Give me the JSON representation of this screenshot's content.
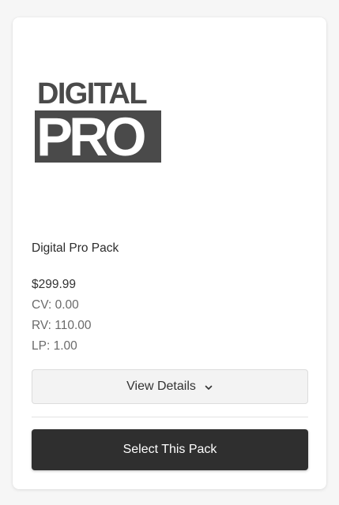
{
  "product": {
    "logo": {
      "top_text": "DIGITAL",
      "bottom_text": "PRO"
    },
    "name": "Digital Pro Pack",
    "price": "$299.99",
    "stats": {
      "cv": "CV: 0.00",
      "rv": "RV: 110.00",
      "lp": "LP: 1.00"
    }
  },
  "actions": {
    "details_label": "View Details",
    "details_icon": "chevron-down-icon",
    "select_label": "Select This Pack"
  },
  "colors": {
    "logo_gray": "#4a4a4a",
    "primary_button": "#2f2f2f",
    "secondary_button": "#f3f3f3"
  }
}
